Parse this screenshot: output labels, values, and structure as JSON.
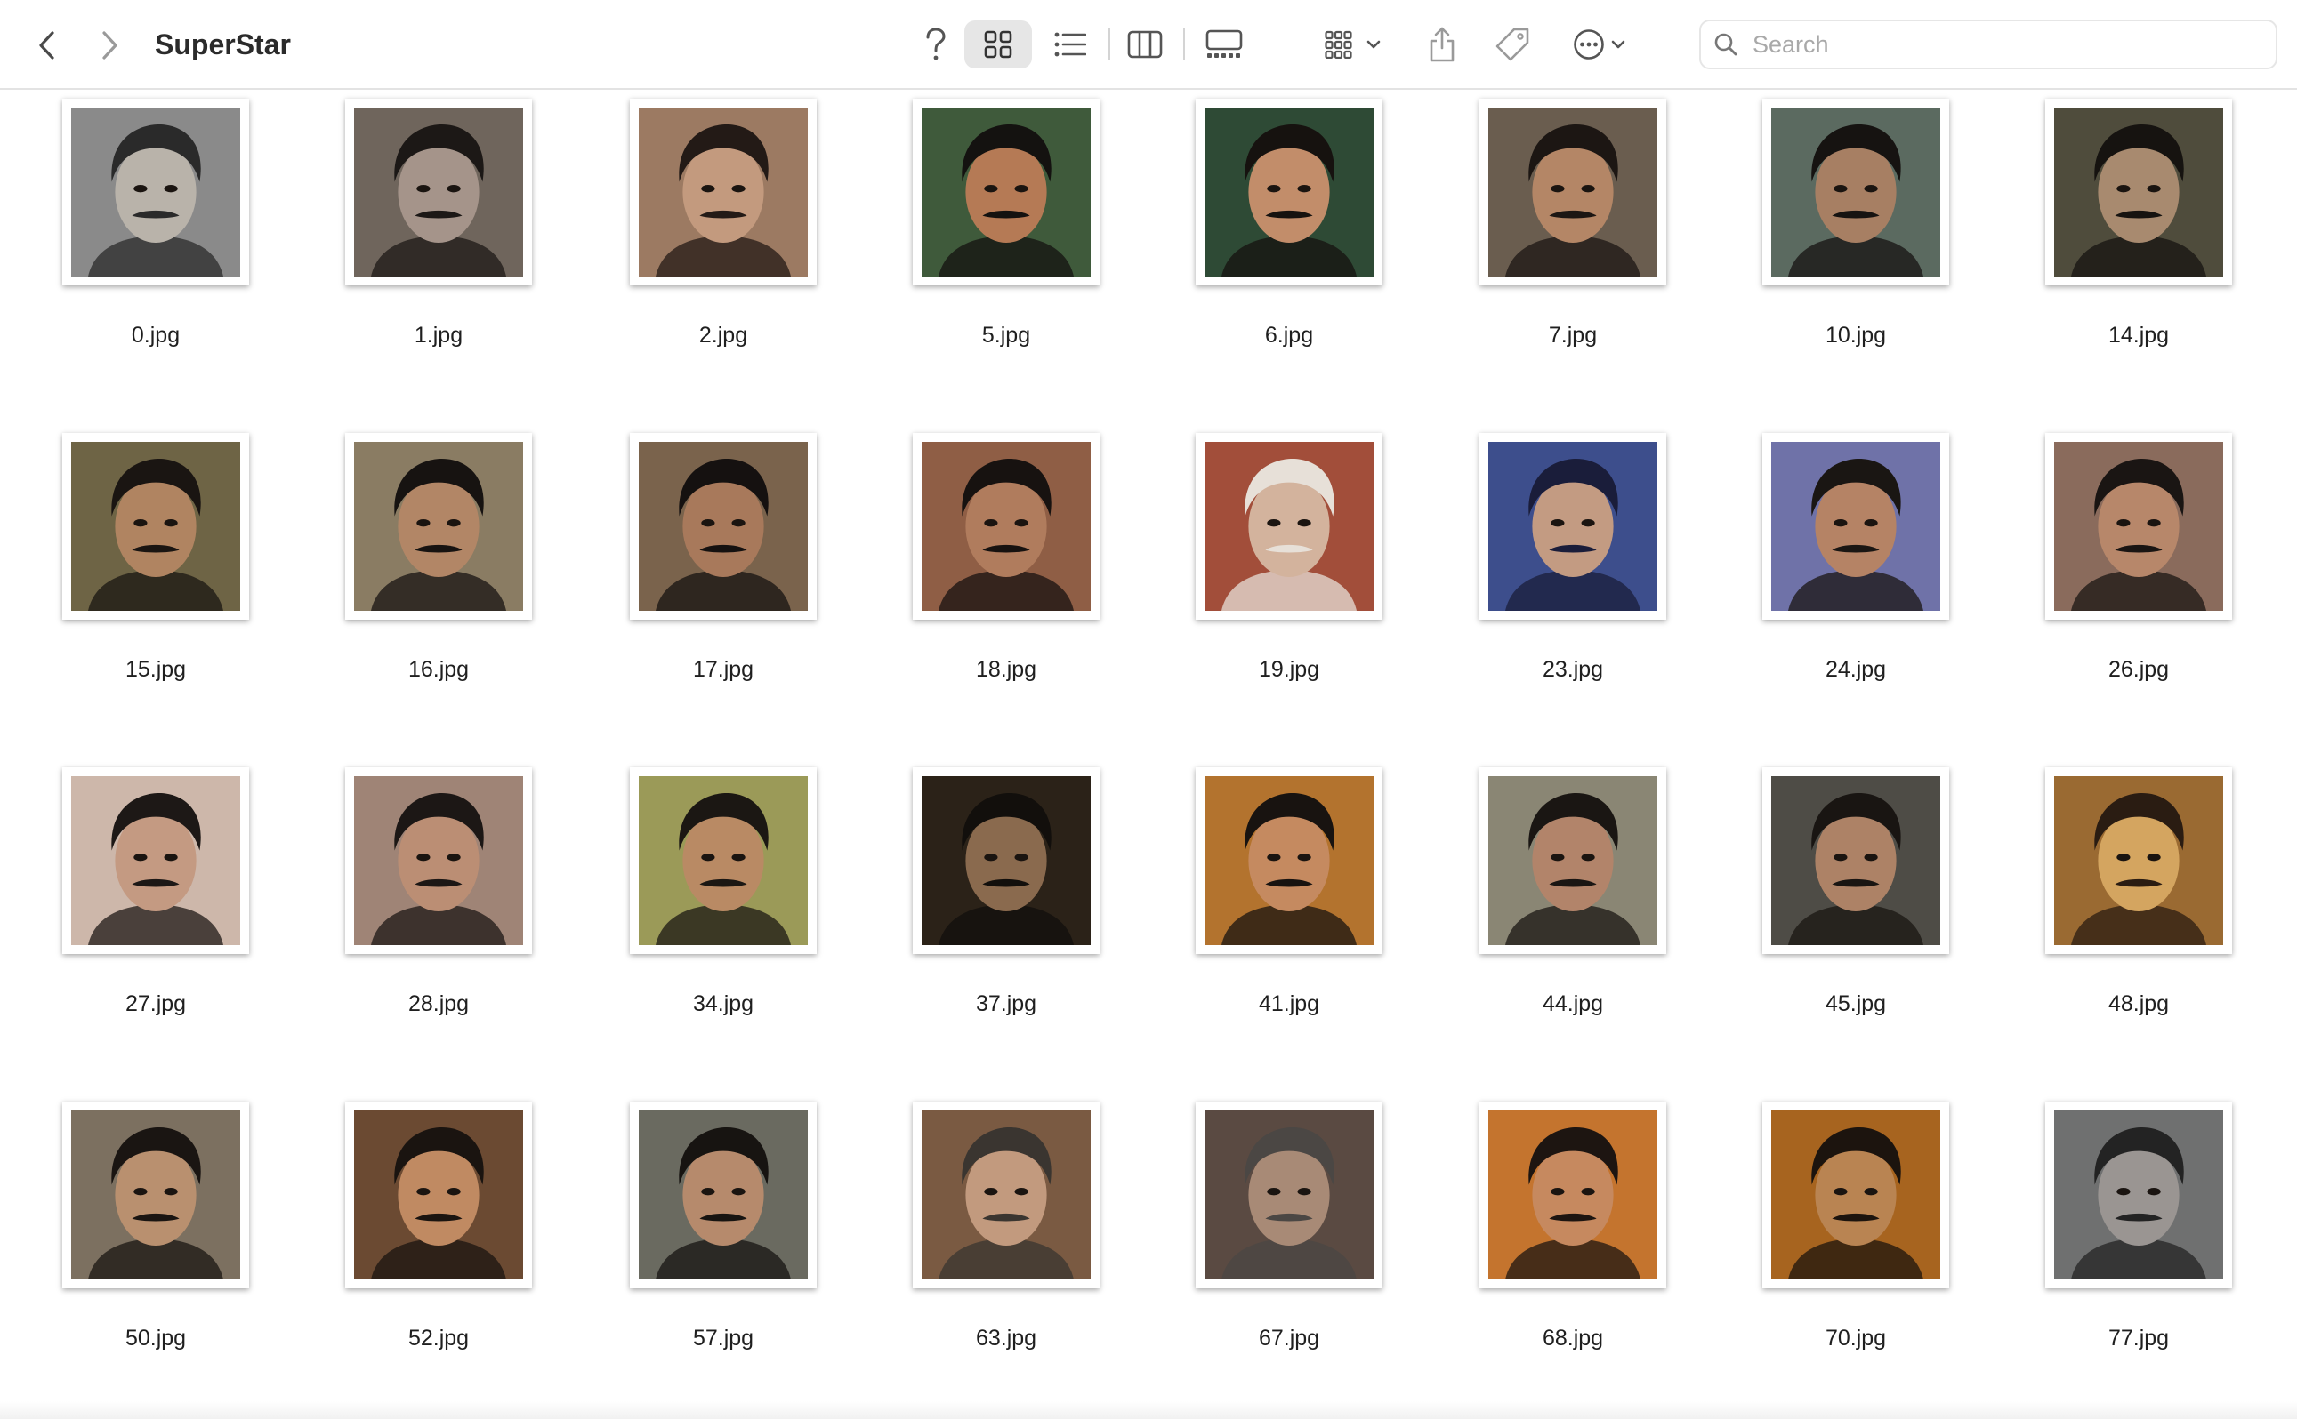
{
  "window": {
    "title": "SuperStar"
  },
  "toolbar": {
    "back_icon": "chevron-left-icon",
    "forward_icon": "chevron-right-icon",
    "help_icon": "question-mark-icon",
    "view_modes": [
      "icon-view",
      "list-view",
      "column-view",
      "gallery-view"
    ],
    "active_view": "icon-view",
    "group_icon": "group-by-icon",
    "share_icon": "share-icon",
    "tag_icon": "tag-icon",
    "more_icon": "ellipsis-circle-icon"
  },
  "search": {
    "placeholder": "Search",
    "value": ""
  },
  "files": [
    {
      "name": "0.jpg",
      "bg": "#8a8a8a",
      "skin": "#b9b3aa",
      "hair": "#2a2a2a"
    },
    {
      "name": "1.jpg",
      "bg": "#6f655c",
      "skin": "#a5948a",
      "hair": "#1c1816"
    },
    {
      "name": "2.jpg",
      "bg": "#9c7a62",
      "skin": "#c39a7e",
      "hair": "#231a16"
    },
    {
      "name": "5.jpg",
      "bg": "#3f5a3b",
      "skin": "#b57a55",
      "hair": "#141210"
    },
    {
      "name": "6.jpg",
      "bg": "#2e4a35",
      "skin": "#c28d6a",
      "hair": "#16120f"
    },
    {
      "name": "7.jpg",
      "bg": "#6a5d4f",
      "skin": "#b48666",
      "hair": "#1c1613"
    },
    {
      "name": "10.jpg",
      "bg": "#5b6a60",
      "skin": "#a77f63",
      "hair": "#161311"
    },
    {
      "name": "14.jpg",
      "bg": "#4f4c3c",
      "skin": "#a88a6f",
      "hair": "#161310"
    },
    {
      "name": "15.jpg",
      "bg": "#6e6445",
      "skin": "#b08461",
      "hair": "#1a1512"
    },
    {
      "name": "16.jpg",
      "bg": "#8a7c63",
      "skin": "#b28666",
      "hair": "#171311"
    },
    {
      "name": "17.jpg",
      "bg": "#7a634c",
      "skin": "#a8795b",
      "hair": "#151110"
    },
    {
      "name": "18.jpg",
      "bg": "#8f5e45",
      "skin": "#b07c5d",
      "hair": "#171210"
    },
    {
      "name": "19.jpg",
      "bg": "#a24e3a",
      "skin": "#d3b39d",
      "hair": "#e7e0d8"
    },
    {
      "name": "23.jpg",
      "bg": "#3d4e8c",
      "skin": "#c39b82",
      "hair": "#1a1d3a"
    },
    {
      "name": "24.jpg",
      "bg": "#6f72a8",
      "skin": "#b58365",
      "hair": "#1a1613"
    },
    {
      "name": "26.jpg",
      "bg": "#8a6b5c",
      "skin": "#b7876a",
      "hair": "#1a1513"
    },
    {
      "name": "27.jpg",
      "bg": "#cdb7aa",
      "skin": "#c49a82",
      "hair": "#1d1816"
    },
    {
      "name": "28.jpg",
      "bg": "#9f8476",
      "skin": "#bb8e74",
      "hair": "#1c1715"
    },
    {
      "name": "34.jpg",
      "bg": "#9b9a58",
      "skin": "#b98a64",
      "hair": "#1b1713"
    },
    {
      "name": "37.jpg",
      "bg": "#2b2218",
      "skin": "#8a6a4e",
      "hair": "#120f0c"
    },
    {
      "name": "41.jpg",
      "bg": "#b3732e",
      "skin": "#c58a60",
      "hair": "#181310"
    },
    {
      "name": "44.jpg",
      "bg": "#8a8674",
      "skin": "#b2846a",
      "hair": "#1a1613"
    },
    {
      "name": "45.jpg",
      "bg": "#4e4c46",
      "skin": "#ad8266",
      "hair": "#191512"
    },
    {
      "name": "48.jpg",
      "bg": "#9a6a32",
      "skin": "#d4a560",
      "hair": "#2a1c12"
    },
    {
      "name": "50.jpg",
      "bg": "#7c7060",
      "skin": "#b9906f",
      "hair": "#1a1512"
    },
    {
      "name": "52.jpg",
      "bg": "#6b4a32",
      "skin": "#c08a62",
      "hair": "#1a1410"
    },
    {
      "name": "57.jpg",
      "bg": "#6a6a60",
      "skin": "#b68a6c",
      "hair": "#171411"
    },
    {
      "name": "63.jpg",
      "bg": "#7a5a42",
      "skin": "#c29a7e",
      "hair": "#3a3530"
    },
    {
      "name": "67.jpg",
      "bg": "#5a4a42",
      "skin": "#a88a76",
      "hair": "#4b4744"
    },
    {
      "name": "68.jpg",
      "bg": "#c4742e",
      "skin": "#c6895f",
      "hair": "#1d1511"
    },
    {
      "name": "70.jpg",
      "bg": "#a7641f",
      "skin": "#b98452",
      "hair": "#1c140e"
    },
    {
      "name": "77.jpg",
      "bg": "#6f7070",
      "skin": "#9a9592",
      "hair": "#232323"
    }
  ]
}
